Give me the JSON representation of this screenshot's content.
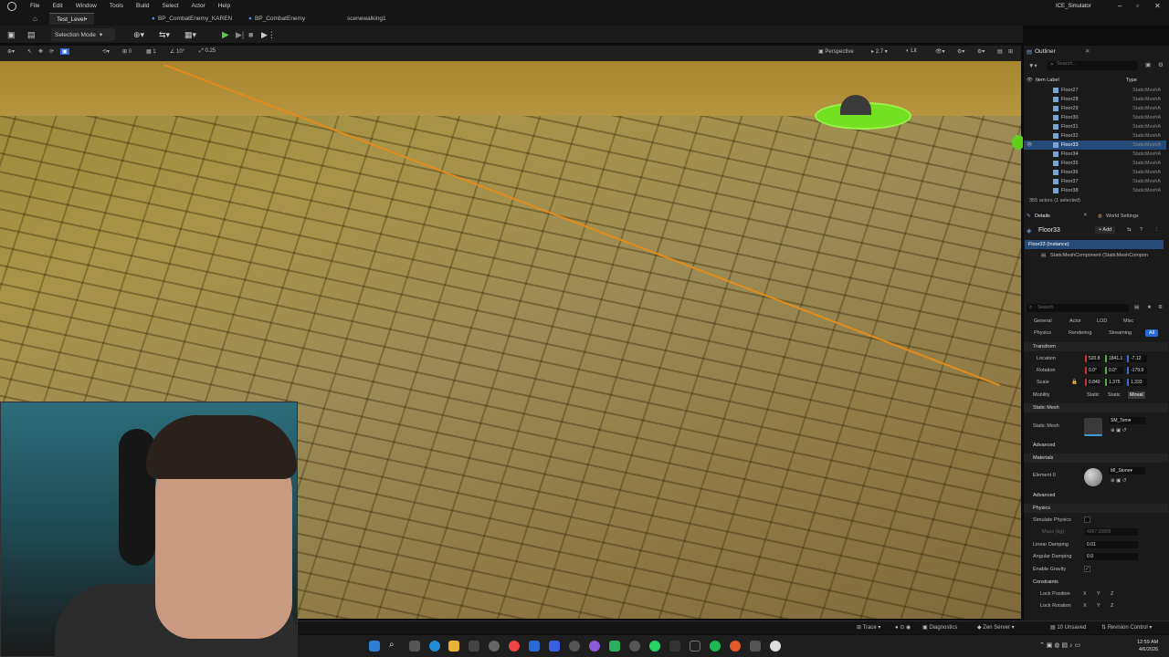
{
  "menu": [
    "File",
    "Edit",
    "Window",
    "Tools",
    "Build",
    "Select",
    "Actor",
    "Help"
  ],
  "tabs": [
    "Test_Level•",
    "BP_CombatEnemy_KAREN",
    "BP_CombatEnemy",
    "scenewalking1"
  ],
  "app_title": "ICE_Simulator",
  "toolbar": {
    "selection_mode": "Selection Mode"
  },
  "viewport_toolbar": {
    "perspective": "Perspective",
    "fov": "2.7",
    "view_mode": "Lit",
    "snap_values": [
      "0",
      "1",
      "10°",
      "0.25"
    ]
  },
  "outliner": {
    "title": "Outliner",
    "search_placeholder": "Search...",
    "col_label": "Item Label",
    "col_type": "Type",
    "rows": [
      {
        "label": "Floor27",
        "type": "StaticMeshA"
      },
      {
        "label": "Floor28",
        "type": "StaticMeshA"
      },
      {
        "label": "Floor29",
        "type": "StaticMeshA"
      },
      {
        "label": "Floor30",
        "type": "StaticMeshA"
      },
      {
        "label": "Floor31",
        "type": "StaticMeshA"
      },
      {
        "label": "Floor32",
        "type": "StaticMeshA"
      },
      {
        "label": "Floor33",
        "type": "StaticMeshA"
      },
      {
        "label": "Floor34",
        "type": "StaticMeshA"
      },
      {
        "label": "Floor35",
        "type": "StaticMeshA"
      },
      {
        "label": "Floor36",
        "type": "StaticMeshA"
      },
      {
        "label": "Floor37",
        "type": "StaticMeshA"
      },
      {
        "label": "Floor38",
        "type": "StaticMeshA"
      }
    ],
    "selected_index": 6,
    "count": "355 actors (1 selected)"
  },
  "details": {
    "tab_details": "Details",
    "tab_world": "World Settings",
    "actor_name": "Floor33",
    "add": "+ Add",
    "instance": "Floor33 (Instance)",
    "component": "StaticMeshComponent (StaticMeshCompon",
    "search_placeholder": "Search",
    "categories_row1": [
      "General",
      "Actor",
      "LOD",
      "Misc"
    ],
    "categories_row2": [
      "Physics",
      "Rendering",
      "Streaming",
      "All"
    ],
    "transform": "Transform",
    "location_label": "Location",
    "location": [
      "520.8",
      "1841.1",
      "-7.12"
    ],
    "rotation_label": "Rotation",
    "rotation": [
      "0.0°",
      "0.0°",
      "-179.9"
    ],
    "scale_label": "Scale",
    "scale": [
      "0.840",
      "1.375",
      "1.333"
    ],
    "mobility_label": "Mobility",
    "mobility": [
      "Static",
      "Static",
      "Moval"
    ],
    "static_mesh_section": "Static Mesh",
    "static_mesh_label": "Static Mesh",
    "static_mesh_value": "SM_Tem",
    "advanced": "Advanced",
    "materials_section": "Materials",
    "element0_label": "Element 0",
    "element0_value": "MI_Stone",
    "physics_section": "Physics",
    "simulate_physics": "Simulate Physics",
    "mass_label": "Mass (kg)",
    "mass_value": "4097.03809",
    "linear_damping_label": "Linear Damping",
    "linear_damping": "0.01",
    "angular_damping_label": "Angular Damping",
    "angular_damping": "0.0",
    "enable_gravity": "Enable Gravity",
    "constraints": "Constraints",
    "lock_position": "Lock Position",
    "lock_rotation": "Lock Rotation",
    "xyz": [
      "X",
      "Y",
      "Z"
    ]
  },
  "statusbar": {
    "trace": "Trace",
    "diagnostics": "Diagnostics",
    "zen": "Zen Server",
    "unsaved": "10 Unsaved",
    "revision": "Revision Control"
  },
  "clock": {
    "time": "12:59 AM",
    "date": "4/6/2026"
  },
  "colors": {
    "accent": "#2a6ad6",
    "selection": "#264a78",
    "selection_outline": "#e38c1b",
    "viewport_floor": "#a08c48"
  }
}
